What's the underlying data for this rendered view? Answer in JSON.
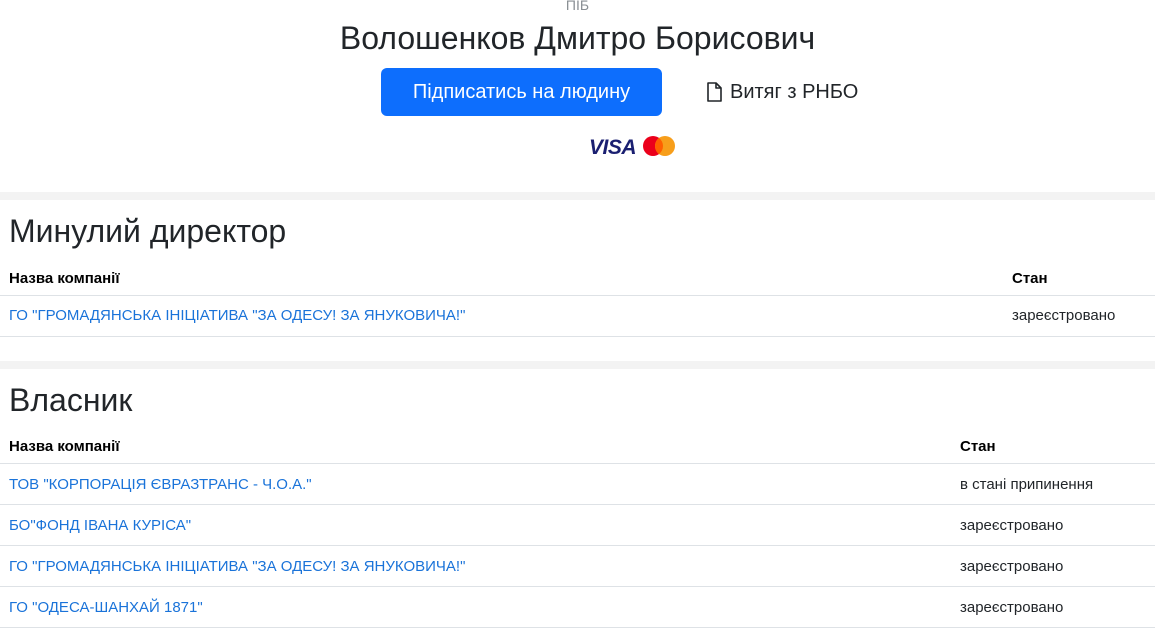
{
  "header": {
    "pib_label": "ПІБ",
    "person_name": "Волошенков Дмитро Борисович",
    "subscribe_label": "Підписатись на людину",
    "extract_label": "Витяг з РНБО",
    "extract_icon": "file-icon",
    "cards": {
      "visa_text": "VISA",
      "mastercard_icon": "mastercard-icon"
    }
  },
  "sections": {
    "director": {
      "title": "Минулий директор",
      "columns": [
        "Назва компанії",
        "Стан"
      ],
      "rows": [
        {
          "company": "ГО \"ГРОМАДЯНСЬКА ІНІЦІАТИВА \"ЗА ОДЕСУ! ЗА ЯНУКОВИЧА!\"",
          "state": "зареєстровано"
        }
      ]
    },
    "owner": {
      "title": "Власник",
      "columns": [
        "Назва компанії",
        "Стан"
      ],
      "rows": [
        {
          "company": "ТОВ \"КОРПОРАЦІЯ ЄВРАЗТРАНС - Ч.О.А.\"",
          "state": "в стані припинення"
        },
        {
          "company": "БО\"ФОНД ІВАНА КУРІСА\"",
          "state": "зареєстровано"
        },
        {
          "company": "ГО \"ГРОМАДЯНСЬКА ІНІЦІАТИВА \"ЗА ОДЕСУ! ЗА ЯНУКОВИЧА!\"",
          "state": "зареєстровано"
        },
        {
          "company": "ГО \"ОДЕСА-ШАНХАЙ 1871\"",
          "state": "зареєстровано"
        }
      ]
    }
  },
  "colors": {
    "primary": "#0d6efd",
    "link": "#1a73d9",
    "visa": "#1a1f71",
    "mastercard_red": "#eb001b",
    "mastercard_orange": "#f79e1b"
  }
}
